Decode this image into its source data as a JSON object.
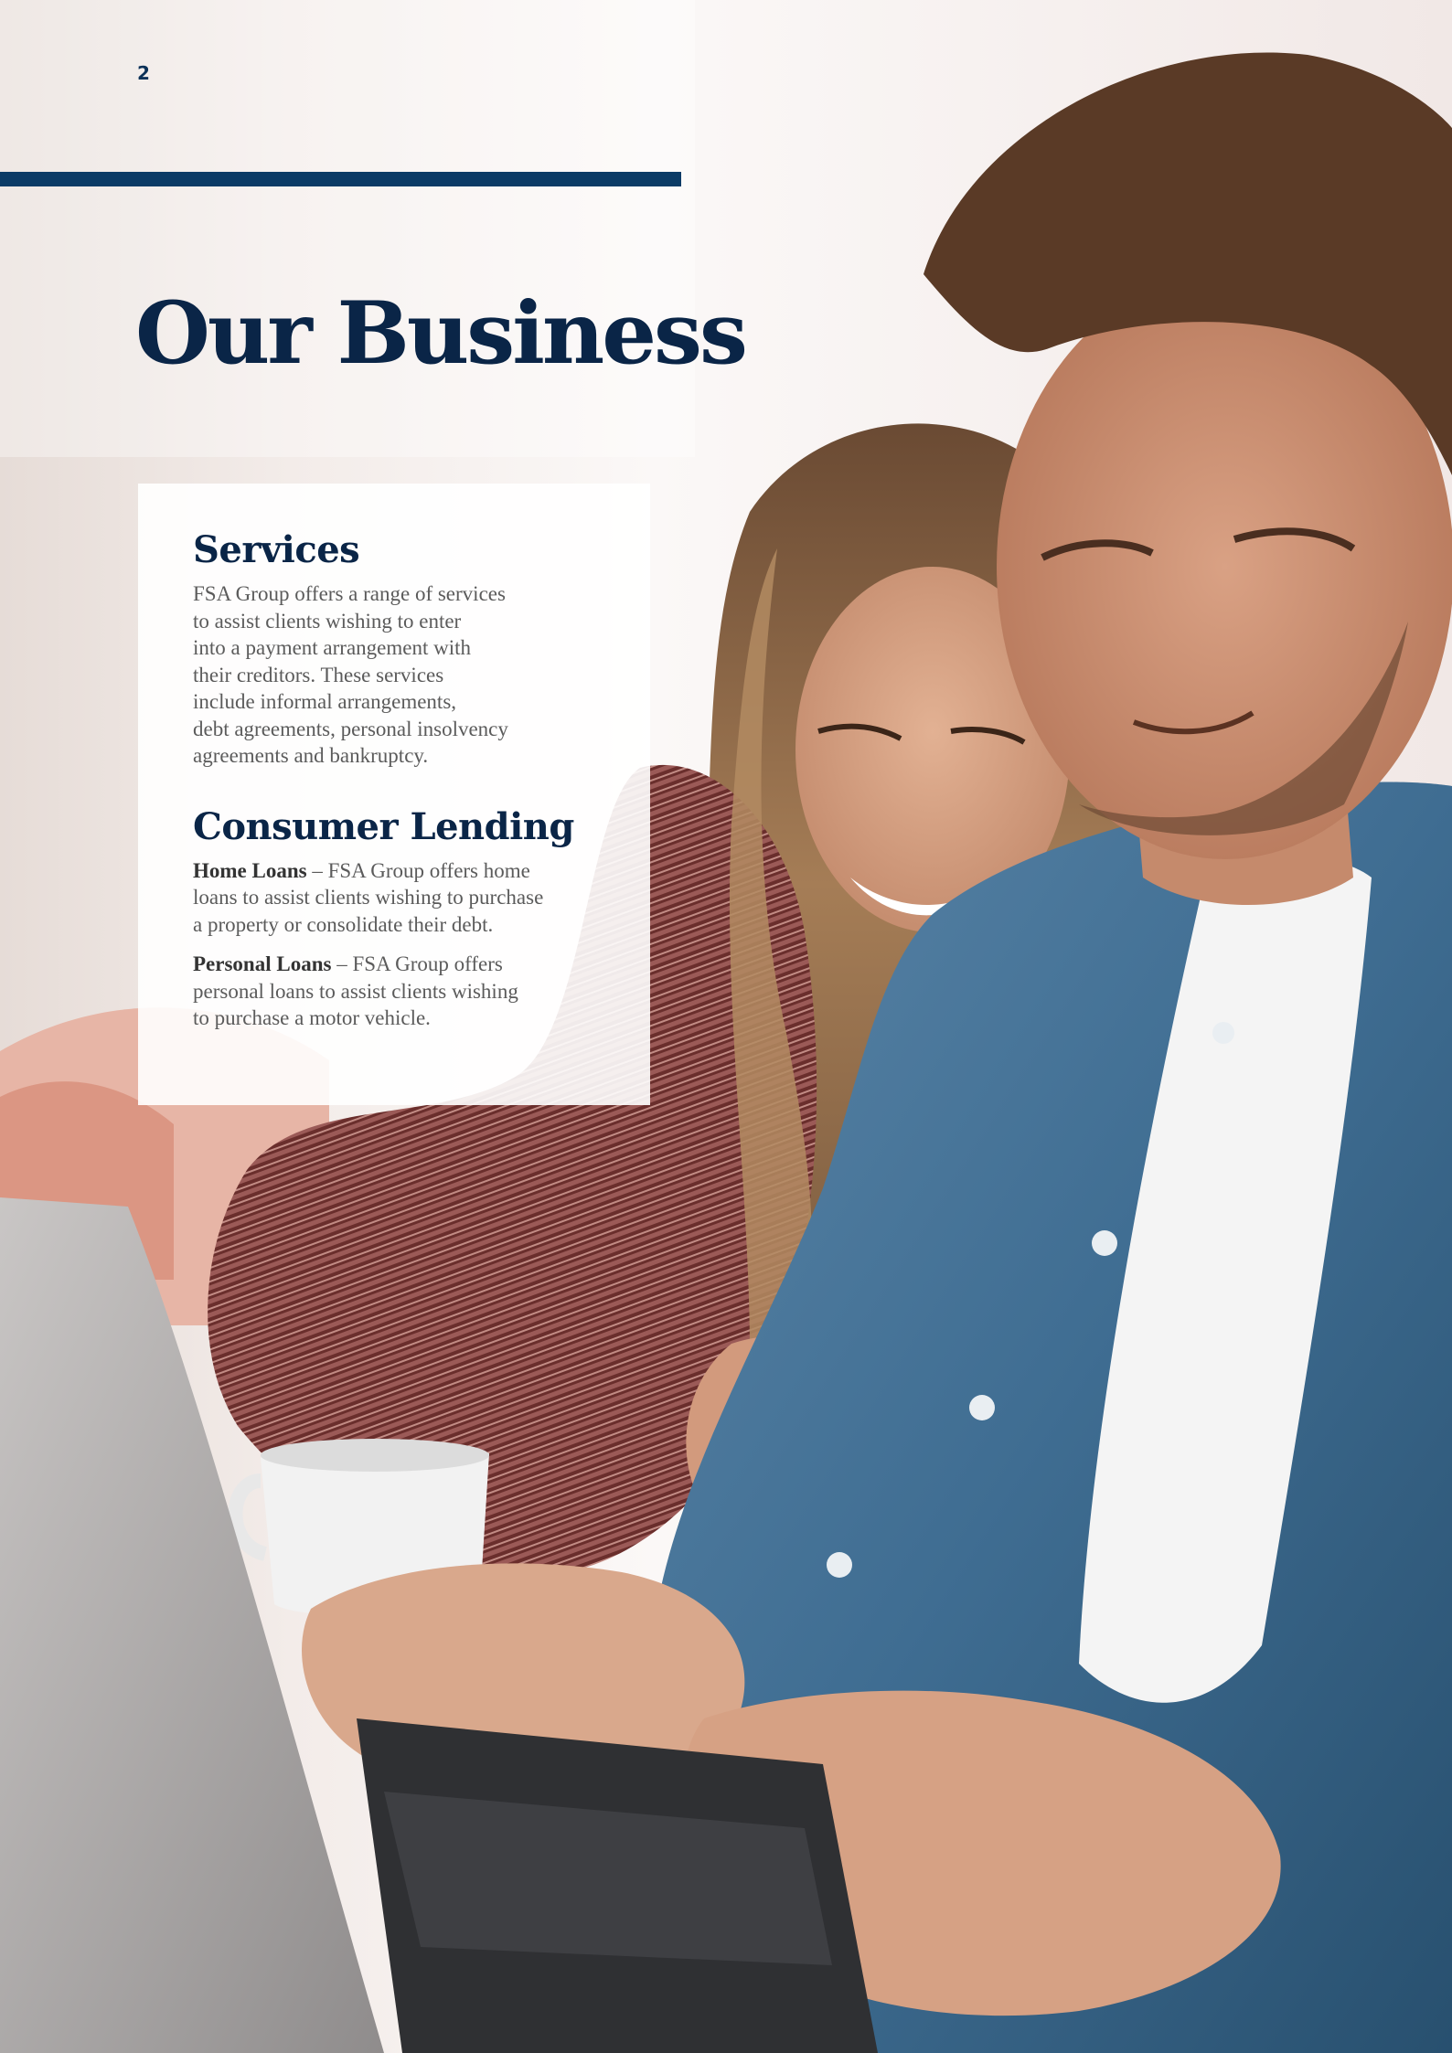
{
  "page": {
    "number": "2",
    "title": "Our Business"
  },
  "services": {
    "heading": "Services",
    "body": "FSA Group offers a range of services\nto assist clients wishing to enter\ninto a payment arrangement with\ntheir creditors. These services\ninclude informal arrangements,\ndebt agreements, personal insolvency\nagreements and bankruptcy."
  },
  "consumer_lending": {
    "heading": "Consumer Lending",
    "home_loans": {
      "label": "Home Loans",
      "text": " – FSA Group offers home\nloans to assist clients wishing to purchase\na property or consolidate their debt."
    },
    "personal_loans": {
      "label": "Personal Loans",
      "text": " – FSA Group offers\npersonal loans to assist clients wishing\nto purchase a motor vehicle."
    }
  },
  "colors": {
    "navy": "#0a2547",
    "accent_rule": "#0b3b66",
    "body_text": "#5b5b5b"
  }
}
